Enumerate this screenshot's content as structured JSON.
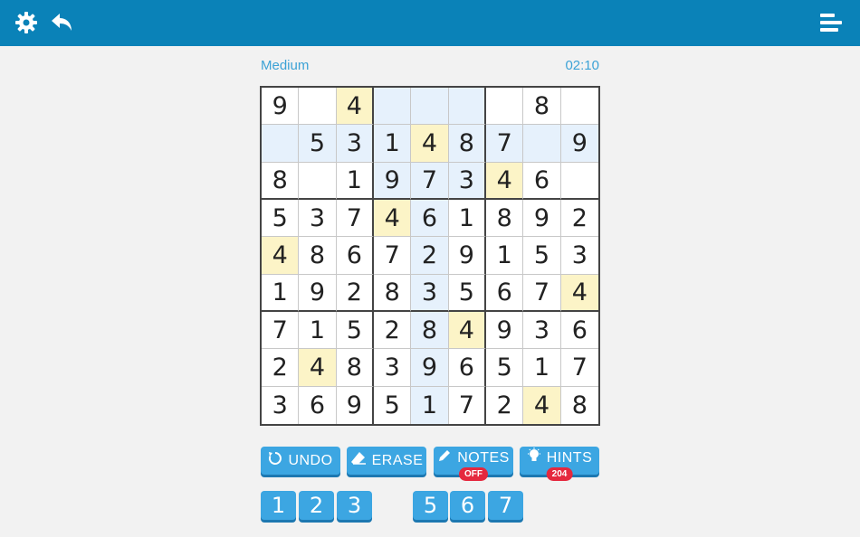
{
  "header": {
    "settings_icon": "gear-icon",
    "back_icon": "undo-arrow-icon",
    "menu_icon": "menu-lines-icon",
    "color": "#0a82b8"
  },
  "status": {
    "difficulty": "Medium",
    "timer": "02:10"
  },
  "board": {
    "cells": [
      [
        "9",
        "",
        "4",
        "",
        "",
        "",
        "",
        "8",
        ""
      ],
      [
        "",
        "5",
        "3",
        "1",
        "4",
        "8",
        "7",
        "",
        "9"
      ],
      [
        "8",
        "",
        "1",
        "9",
        "7",
        "3",
        "4",
        "6",
        ""
      ],
      [
        "5",
        "3",
        "7",
        "4",
        "6",
        "1",
        "8",
        "9",
        "2"
      ],
      [
        "4",
        "8",
        "6",
        "7",
        "2",
        "9",
        "1",
        "5",
        "3"
      ],
      [
        "1",
        "9",
        "2",
        "8",
        "3",
        "5",
        "6",
        "7",
        "4"
      ],
      [
        "7",
        "1",
        "5",
        "2",
        "8",
        "4",
        "9",
        "3",
        "6"
      ],
      [
        "2",
        "4",
        "8",
        "3",
        "9",
        "6",
        "5",
        "1",
        "7"
      ],
      [
        "3",
        "6",
        "9",
        "5",
        "1",
        "7",
        "2",
        "4",
        "8"
      ]
    ],
    "highlights": [
      [
        "",
        "",
        "y",
        "b",
        "b",
        "b",
        "",
        "",
        ""
      ],
      [
        "b",
        "b",
        "b",
        "b",
        "y",
        "b",
        "b",
        "b",
        "b"
      ],
      [
        "",
        "",
        "",
        "b",
        "b",
        "b",
        "y",
        "",
        ""
      ],
      [
        "",
        "",
        "",
        "y",
        "b",
        "",
        "",
        "",
        ""
      ],
      [
        "y",
        "",
        "",
        "",
        "b",
        "",
        "",
        "",
        ""
      ],
      [
        "",
        "",
        "",
        "",
        "b",
        "",
        "",
        "",
        "y"
      ],
      [
        "",
        "",
        "",
        "",
        "b",
        "y",
        "",
        "",
        ""
      ],
      [
        "",
        "y",
        "",
        "",
        "b",
        "",
        "",
        "",
        ""
      ],
      [
        "",
        "",
        "",
        "",
        "b",
        "",
        "",
        "y",
        ""
      ]
    ],
    "colors": {
      "highlight_blue": "#e6f1fc",
      "highlight_yellow": "#fcf4c7"
    }
  },
  "actions": {
    "undo": {
      "label": "UNDO",
      "icon": "rotate-icon"
    },
    "erase": {
      "label": "ERASE",
      "icon": "eraser-icon"
    },
    "notes": {
      "label": "NOTES",
      "icon": "pencil-icon",
      "badge": "OFF"
    },
    "hints": {
      "label": "HINTS",
      "icon": "lightbulb-icon",
      "badge": "204"
    }
  },
  "numpad": [
    "1",
    "2",
    "3",
    "5",
    "6",
    "7"
  ],
  "accent_color": "#3ca6e2",
  "badge_color": "#e5283e"
}
